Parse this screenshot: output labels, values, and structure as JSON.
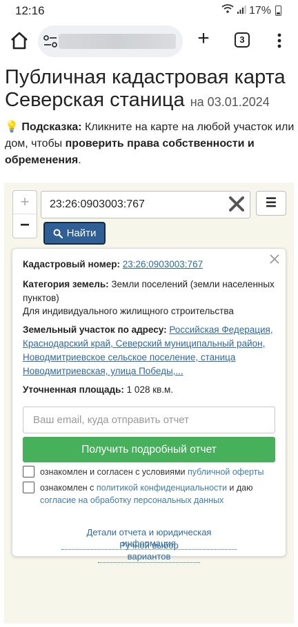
{
  "status_bar": {
    "time": "12:16",
    "battery": "17%"
  },
  "browser": {
    "tabs_count": "3",
    "new_tab_label": "+"
  },
  "page": {
    "title": "Публичная кадастровая карта Северская станица",
    "date": "на 03.01.2024",
    "hint_icon": "💡",
    "hint_label": "Подсказка:",
    "hint_text": " Кликните на карте на любой участок или дом, чтобы ",
    "hint_bold": "проверить права собственности и обременения",
    "hint_end": "."
  },
  "map": {
    "zoom_in": "+",
    "zoom_out": "−",
    "search_value": "23:26:0903003:767",
    "find_button": "Найти",
    "list_button": "☰"
  },
  "popup": {
    "cad_label": "Кадастровый номер:",
    "cad_value": "23:26:0903003:767",
    "category_label": "Категория земель:",
    "category_value": " Земли поселений (земли населенных пунктов)",
    "usage_value": "Для индивидуального жилищного строительства",
    "address_label": "Земельный участок по адресу:",
    "address_value": "Российская Федерация, Краснодарский край, Северский муниципальный район, Новодмитриевское сельское поселение, станица Новодмитриевская, улица Победы,...",
    "area_label": "Уточненная площадь:",
    "area_value": " 1 028 кв.м.",
    "email_placeholder": "Ваш email, куда отправить отчет",
    "report_button": "Получить подробный отчет",
    "consent1_text": "ознакомлен и согласен с условиями ",
    "consent1_link": "публичной оферты",
    "consent2_text": "ознакомлен с ",
    "consent2_link1": "политикой конфиденциальности",
    "consent2_mid": " и даю ",
    "consent2_link2": "согласие на обработку персональных данных",
    "details_link": "Детали отчета и юридическая информация",
    "manual_link": "Ручной выбор вариантов"
  },
  "colors": {
    "find_button": "#2f5f95",
    "report_button": "#47b05a",
    "link": "#2e6aa0",
    "map_background": "#f6f6ea"
  },
  "icons": [
    "home-icon",
    "tune-icon",
    "plus-icon",
    "tabs-icon",
    "more-vert-icon",
    "search-icon",
    "close-icon",
    "menu-icon",
    "lightbulb-icon"
  ]
}
